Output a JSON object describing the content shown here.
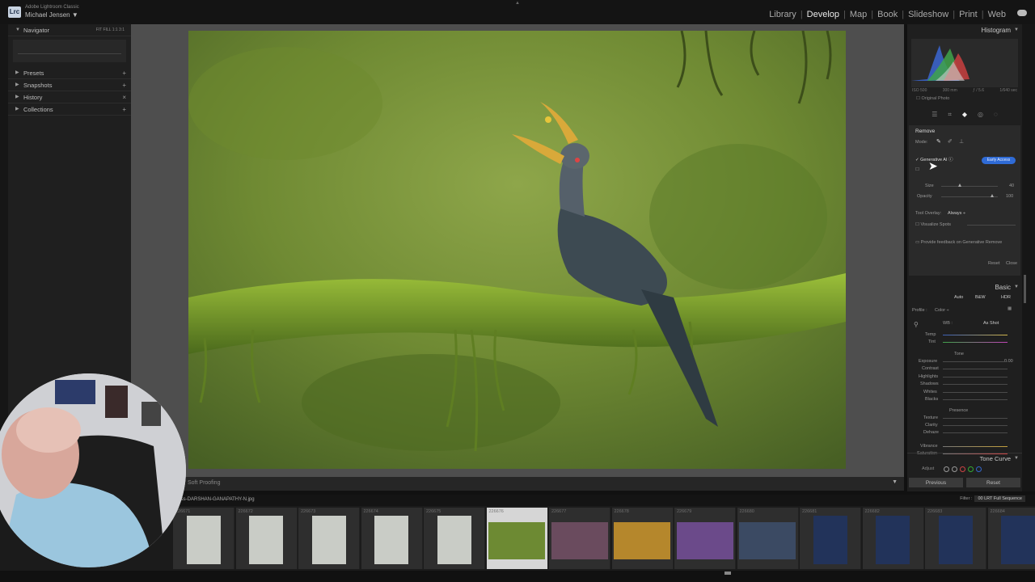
{
  "app": {
    "product": "Adobe Lightroom Classic",
    "logo": "Lrc",
    "user": "Michael Jensen",
    "user_caret": "▼"
  },
  "modules": [
    "Library",
    "Develop",
    "Map",
    "Book",
    "Slideshow",
    "Print",
    "Web"
  ],
  "active_module": "Develop",
  "left_panel": {
    "navigator": {
      "label": "Navigator",
      "zoom_options": "FIT  FILL  1:1  3:1"
    },
    "sections": [
      "Presets",
      "Snapshots",
      "History",
      "Collections"
    ]
  },
  "toolbar": {
    "soft_proofing": "Soft Proofing"
  },
  "right_panel": {
    "histogram": {
      "label": "Histogram",
      "iso": "ISO 500",
      "focal": "300 mm",
      "aperture": "ƒ / 5.6",
      "shutter": "1/640 sec",
      "original_photo": "Original Photo"
    },
    "remove": {
      "title": "Remove",
      "mode_label": "Mode:",
      "generative_ai": "Generative AI",
      "early_access": "Early Access",
      "size_label": "Size",
      "size_value": "40",
      "opacity_label": "Opacity",
      "opacity_value": "100",
      "tool_overlay_label": "Tool Overlay:",
      "tool_overlay_value": "Always",
      "visualize_spots": "Visualize Spots",
      "feedback": "Provide feedback on Generative Remove",
      "reset": "Reset",
      "close": "Close"
    },
    "basic": {
      "label": "Basic",
      "auto": "Auto",
      "bw": "B&W",
      "hdr": "HDR",
      "profile_label": "Profile :",
      "profile_value": "Color",
      "wb_label": "WB :",
      "wb_value": "As Shot",
      "temp": "Temp",
      "tint": "Tint",
      "tone": "Tone",
      "tone_sliders": [
        "Exposure",
        "Contrast",
        "Highlights",
        "Shadows",
        "Whites",
        "Blacks"
      ],
      "exposure_value": "0.00",
      "presence": "Presence",
      "presence_sliders": [
        "Texture",
        "Clarity",
        "Dehaze"
      ],
      "color_sliders": [
        "Vibrance",
        "Saturation"
      ]
    },
    "tone_curve": "Tone Curve",
    "adjust": "Adjust",
    "previous": "Previous",
    "reset": "Reset"
  },
  "filmstrip": {
    "filename": "_Toss-DARSHAN-GANAPATHY-N.jpg",
    "filter_label": "Filter :",
    "filter_value": "00 LRT Full Sequence",
    "cells": [
      {
        "num": "226671",
        "kind": "egret"
      },
      {
        "num": "226672",
        "kind": "egret"
      },
      {
        "num": "226673",
        "kind": "egret"
      },
      {
        "num": "226674",
        "kind": "egret"
      },
      {
        "num": "226675",
        "kind": "egret"
      },
      {
        "num": "226676",
        "kind": "bird",
        "selected": true
      },
      {
        "num": "226677",
        "kind": "sunset"
      },
      {
        "num": "226678",
        "kind": "gold"
      },
      {
        "num": "226679",
        "kind": "purple"
      },
      {
        "num": "226680",
        "kind": "dusk"
      },
      {
        "num": "226681",
        "kind": "night"
      },
      {
        "num": "226682",
        "kind": "night"
      },
      {
        "num": "226683",
        "kind": "night"
      },
      {
        "num": "226684",
        "kind": "night"
      }
    ]
  },
  "colors": {
    "accent": "#2f6bd6",
    "panel": "#1f1f1f",
    "background": "#4e4e4e"
  }
}
